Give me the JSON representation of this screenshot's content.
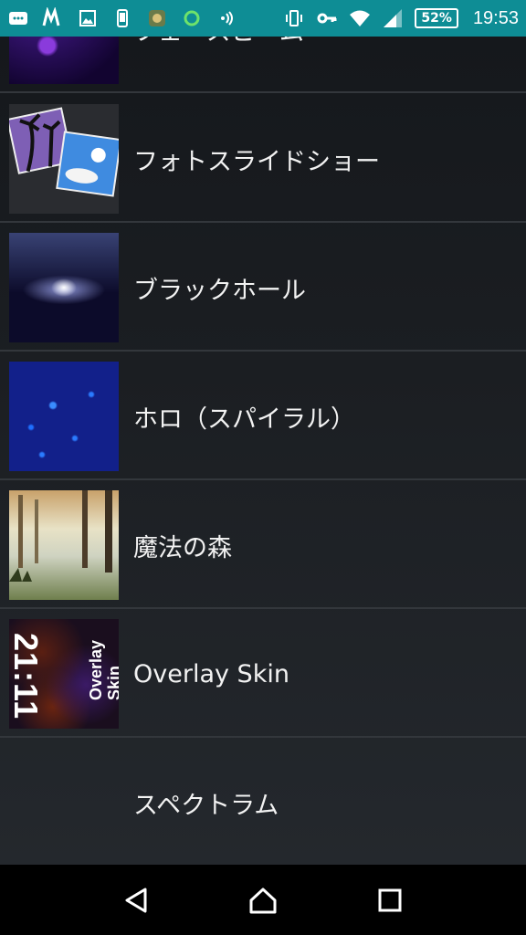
{
  "status_bar": {
    "battery": "52%",
    "time": "19:53",
    "icons": [
      "message-icon",
      "app-icon",
      "gallery-icon",
      "phone-icon",
      "game-icon",
      "circle-icon",
      "nfc-icon",
      "vibrate-icon",
      "key-icon",
      "wifi-icon",
      "signal-icon"
    ]
  },
  "list": {
    "items": [
      {
        "label": "フェースビーム",
        "thumb": "purple-bokeh"
      },
      {
        "label": "フォトスライドショー",
        "thumb": "photo-slideshow"
      },
      {
        "label": "ブラックホール",
        "thumb": "black-hole"
      },
      {
        "label": "ホロ（スパイラル）",
        "thumb": "holo-spiral"
      },
      {
        "label": "魔法の森",
        "thumb": "magic-forest"
      },
      {
        "label": "Overlay Skin",
        "thumb": "overlay-skin",
        "thumb_time": "21:11",
        "thumb_text": "Overlay Skin"
      },
      {
        "label": "スペクトラム",
        "thumb": "spectrum"
      }
    ]
  },
  "nav": {
    "back": "back-icon",
    "home": "home-icon",
    "recents": "recents-icon"
  }
}
